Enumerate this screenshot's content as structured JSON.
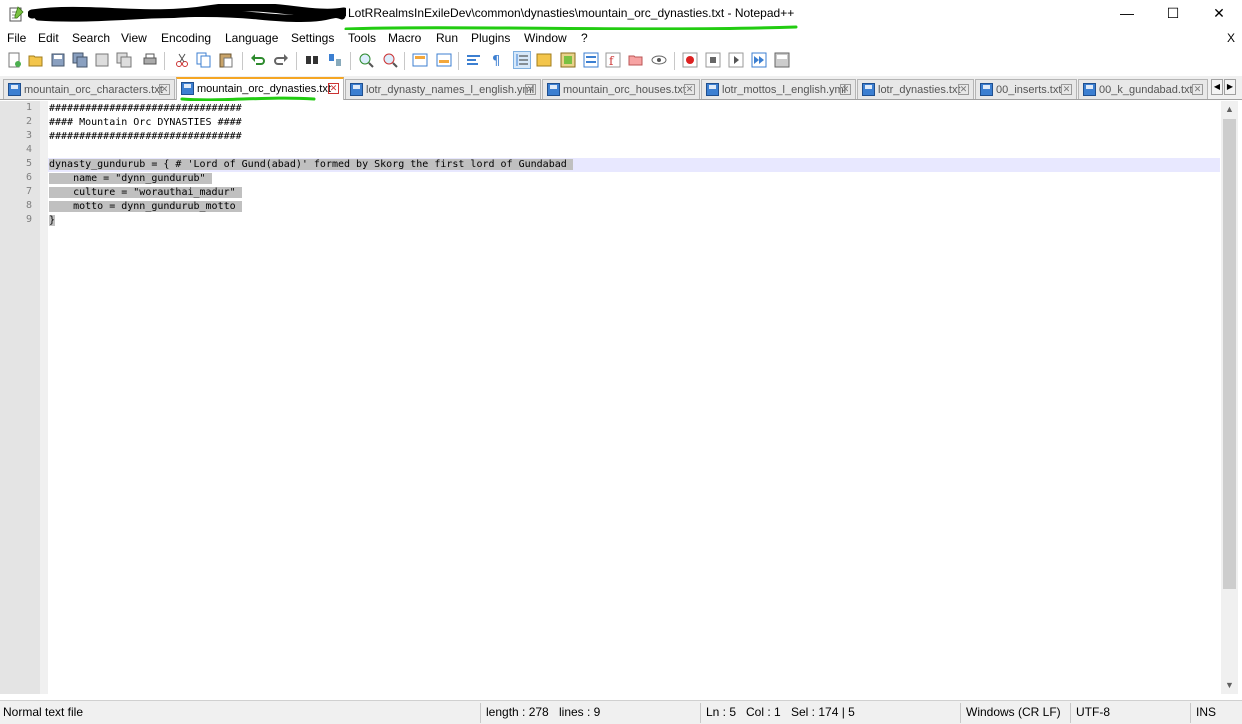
{
  "window": {
    "title": "LotRRealmsInExileDev\\common\\dynasties\\mountain_orc_dynasties.txt - Notepad++",
    "minimize_label": "—",
    "maximize_label": "☐",
    "close_label": "✕"
  },
  "menu": {
    "items": [
      "File",
      "Edit",
      "Search",
      "View",
      "Encoding",
      "Language",
      "Settings",
      "Tools",
      "Macro",
      "Run",
      "Plugins",
      "Window",
      "?"
    ],
    "close_label": "X"
  },
  "toolbar": {
    "icons": [
      "new-file-icon",
      "open-file-icon",
      "save-icon",
      "save-all-icon",
      "close-icon",
      "close-all-icon",
      "print-icon",
      "cut-icon",
      "copy-icon",
      "paste-icon",
      "undo-icon",
      "redo-icon",
      "find-icon",
      "replace-icon",
      "zoom-in-icon",
      "zoom-out-icon",
      "sync-vertical-icon",
      "sync-horizontal-icon",
      "word-wrap-icon",
      "show-all-chars-icon",
      "indent-guide-icon",
      "udl-icon",
      "document-map-icon",
      "function-list-icon",
      "folder-workspace-icon",
      "monitoring-icon",
      "record-macro-icon",
      "stop-record-icon",
      "playback-macro-icon",
      "run-macro-multiple-icon",
      "save-macro-icon"
    ]
  },
  "tabs": [
    {
      "label": "mountain_orc_characters.txt",
      "active": false
    },
    {
      "label": "mountain_orc_dynasties.txt",
      "active": true
    },
    {
      "label": "lotr_dynasty_names_l_english.yml",
      "active": false
    },
    {
      "label": "mountain_orc_houses.txt",
      "active": false
    },
    {
      "label": "lotr_mottos_l_english.yml",
      "active": false
    },
    {
      "label": "lotr_dynasties.txt",
      "active": false
    },
    {
      "label": "00_inserts.txt",
      "active": false
    },
    {
      "label": "00_k_gundabad.txt",
      "active": false
    }
  ],
  "tab_close_label": "✕",
  "editor": {
    "line_numbers": [
      "1",
      "2",
      "3",
      "4",
      "5",
      "6",
      "7",
      "8",
      "9"
    ],
    "lines": [
      "################################",
      "#### Mountain Orc DYNASTIES ####",
      "################################",
      "",
      "dynasty_gundurub = { # 'Lord of Gund(abad)' formed by Skorg the first lord of Gundabad ",
      "    name = \"dynn_gundurub\" ",
      "    culture = \"worauthai_madur\" ",
      "    motto = dynn_gundurub_motto ",
      "}"
    ]
  },
  "status": {
    "file_type": "Normal text file",
    "length": "length : 278",
    "lines": "lines : 9",
    "ln": "Ln : 5",
    "col": "Col : 1",
    "sel": "Sel : 174 | 5",
    "eol": "Windows (CR LF)",
    "encoding": "UTF-8",
    "mode": "INS"
  },
  "colors": {
    "annotation": "#22cc11",
    "active_tab_accent": "#f5a623",
    "selection": "#c0c0c0",
    "current_line": "#e8e8ff"
  }
}
